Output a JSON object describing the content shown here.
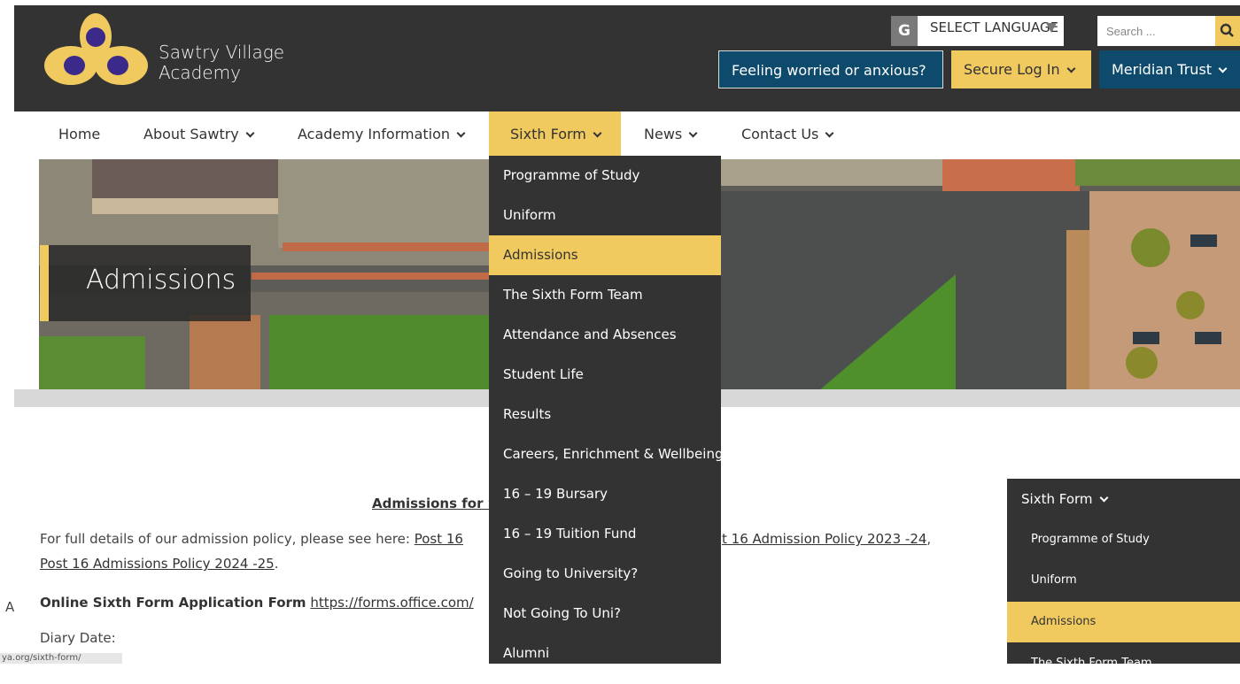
{
  "header": {
    "logo_line1": "Sawtry Village",
    "logo_line2": "Academy",
    "translate_icon": "G",
    "language_label": "SELECT LANGUAGE",
    "search_placeholder": "Search ...",
    "worried_button": "Feeling worried or anxious?",
    "secure_login": "Secure Log In",
    "meridian_trust": "Meridian Trust",
    "colors": {
      "dark": "#333333",
      "gold": "#f0c95f",
      "navy": "#0e4a6c"
    }
  },
  "nav": {
    "home": "Home",
    "about": "About Sawtry",
    "academy_info": "Academy Information",
    "sixth_form": "Sixth Form",
    "news": "News",
    "contact": "Contact Us"
  },
  "hero": {
    "title": "Admissions"
  },
  "dropdown": {
    "items": [
      "Programme of Study",
      "Uniform",
      "Admissions",
      "The Sixth Form Team",
      "Attendance and Absences",
      "Student Life",
      "Results",
      "Careers, Enrichment & Wellbeing",
      "16 – 19 Bursary",
      "16 – 19 Tuition Fund",
      "Going to University?",
      "Not Going To Uni?",
      "Alumni"
    ],
    "active_index": 2
  },
  "content": {
    "heading": "Admissions for S",
    "policy_text": "For full details of our admission policy, please see here: ",
    "policy_link1": "Post 16",
    "policy_link2": "t 16 Admission Policy 2023 -24",
    "policy_comma": ",",
    "policy_link3": "Post 16 Admissions Policy 2024 -25",
    "policy_end": ".",
    "form_label": "Online Sixth Form Application Form",
    "form_link": "https://forms.office.com/",
    "diary": "Diary Date:",
    "left_sliver": "A",
    "status_url": "ya.org/sixth-form/"
  },
  "side_menu": {
    "title": "Sixth Form",
    "items": [
      "Programme of Study",
      "Uniform",
      "Admissions",
      "The Sixth Form Team"
    ],
    "active_index": 2
  }
}
